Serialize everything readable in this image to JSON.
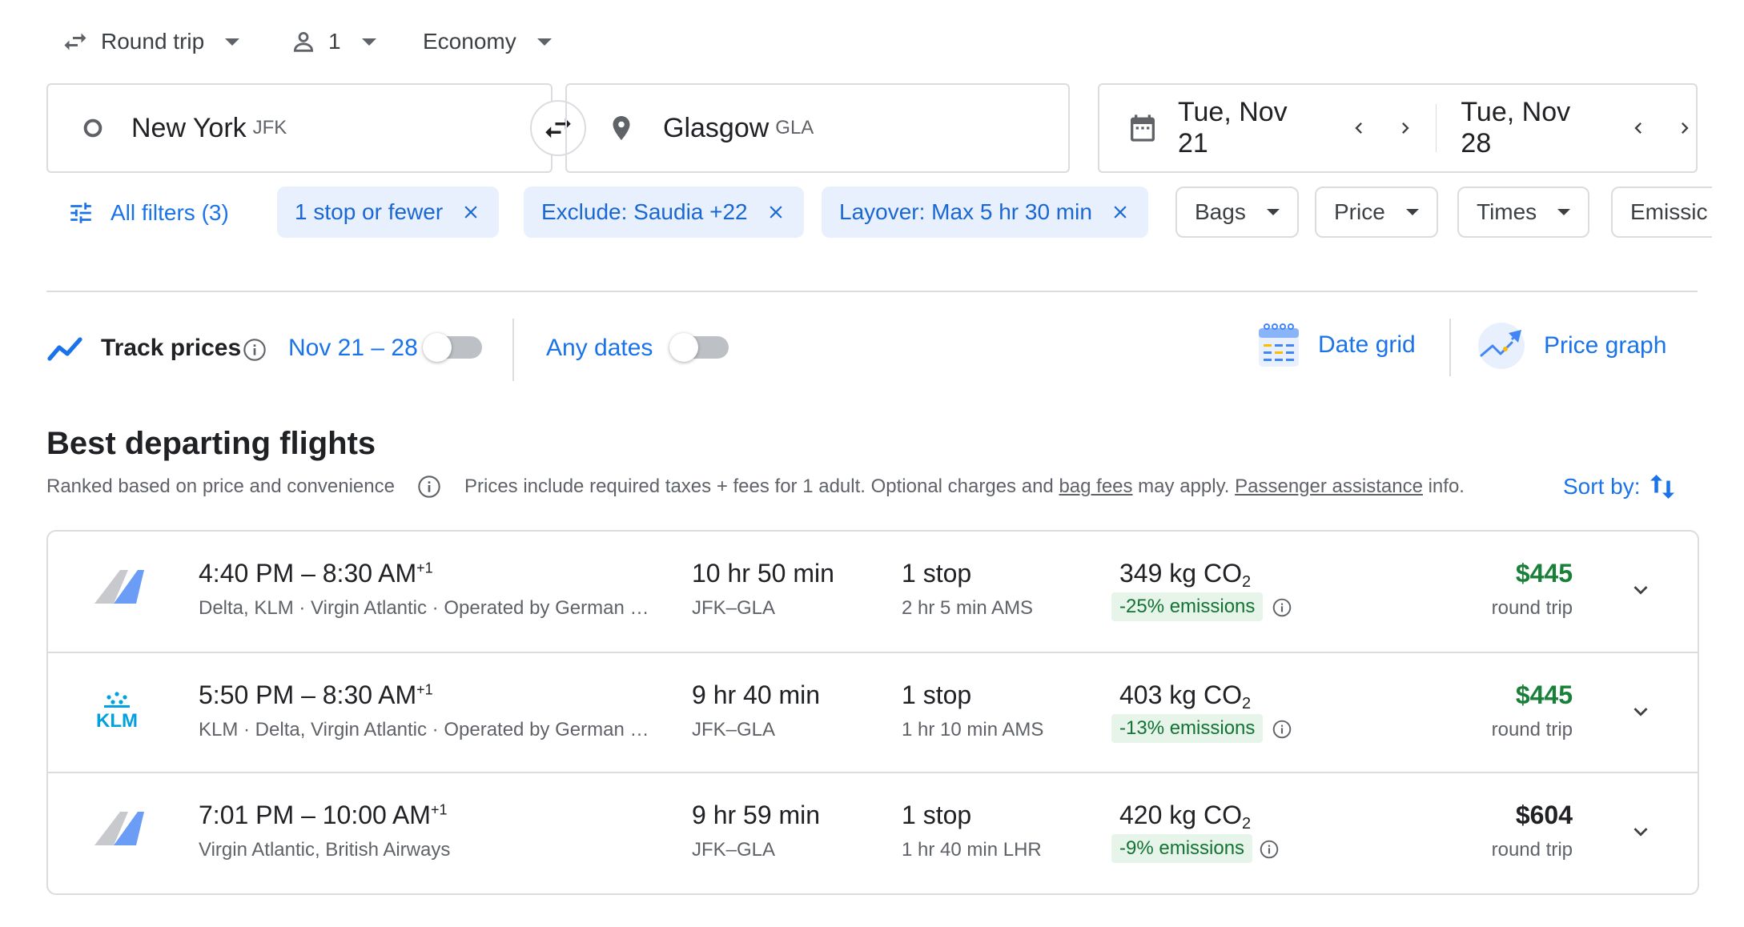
{
  "trip": {
    "type": "Round trip",
    "passengers": "1",
    "cabin": "Economy"
  },
  "search": {
    "origin_city": "New York",
    "origin_code": "JFK",
    "dest_city": "Glasgow",
    "dest_code": "GLA",
    "depart_date": "Tue, Nov 21",
    "return_date": "Tue, Nov 28"
  },
  "filters": {
    "all_filters": "All filters (3)",
    "chips": [
      "1 stop or fewer",
      "Exclude: Saudia +22",
      "Layover: Max 5 hr 30 min"
    ],
    "dropdowns": [
      "Bags",
      "Price",
      "Times",
      "Emissic"
    ]
  },
  "track": {
    "label": "Track prices",
    "dates": "Nov 21 – 28",
    "any_dates": "Any dates",
    "date_grid": "Date grid",
    "price_graph": "Price graph"
  },
  "results": {
    "heading": "Best departing flights",
    "ranked_note": "Ranked based on price and convenience",
    "prices_note_1": "Prices include required taxes + fees for 1 adult. Optional charges and ",
    "bag_fees": "bag fees",
    "prices_note_2": " may apply. ",
    "passenger_assistance": "Passenger assistance",
    "prices_note_3": " info.",
    "sort_by": "Sort by:"
  },
  "flights": [
    {
      "times": "4:40 PM – 8:30 AM",
      "plus_day": "+1",
      "airlines": "Delta, KLM · Virgin Atlantic · Operated by German …",
      "duration": "10 hr 50 min",
      "route": "JFK–GLA",
      "stops": "1 stop",
      "layover": "2 hr 5 min AMS",
      "co2": "349 kg CO",
      "co2_sub": "2",
      "emissions": "-25% emissions",
      "price": "$445",
      "price_note": "round trip",
      "price_color": "#188038",
      "logo": "generic-tail"
    },
    {
      "times": "5:50 PM – 8:30 AM",
      "plus_day": "+1",
      "airlines": "KLM · Delta, Virgin Atlantic · Operated by German …",
      "duration": "9 hr 40 min",
      "route": "JFK–GLA",
      "stops": "1 stop",
      "layover": "1 hr 10 min AMS",
      "co2": "403 kg CO",
      "co2_sub": "2",
      "emissions": "-13% emissions",
      "price": "$445",
      "price_note": "round trip",
      "price_color": "#188038",
      "logo": "KLM"
    },
    {
      "times": "7:01 PM – 10:00 AM",
      "plus_day": "+1",
      "airlines": "Virgin Atlantic, British Airways",
      "duration": "9 hr 59 min",
      "route": "JFK–GLA",
      "stops": "1 stop",
      "layover": "1 hr 40 min LHR",
      "co2": "420 kg CO",
      "co2_sub": "2",
      "emissions": "-9% emissions",
      "price": "$604",
      "price_note": "round trip",
      "price_color": "#202124",
      "logo": "generic-tail"
    }
  ]
}
